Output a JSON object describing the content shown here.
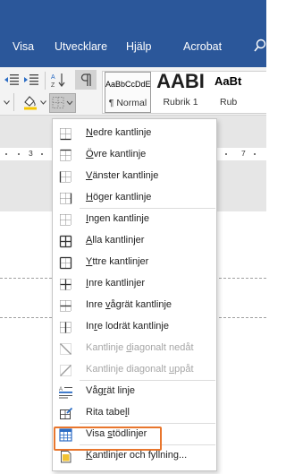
{
  "ribbon_tabs": [
    "Visa",
    "Utvecklare",
    "Hjälp",
    "Acrobat"
  ],
  "search": {
    "icon": "search-icon"
  },
  "toolbar": {
    "icons": [
      "decrease-indent-icon",
      "increase-indent-icon",
      "sort-icon",
      "paragraph-mark-icon",
      "shading-icon",
      "borders-icon",
      "dropdown-arrow-icon"
    ]
  },
  "styles": [
    {
      "sample": "AaBbCcDdE",
      "name": "¶ Normal",
      "selected": true
    },
    {
      "sample": "AABI",
      "name": "Rubrik 1",
      "selected": false
    },
    {
      "sample": "AaBt",
      "name": "Rub",
      "selected": false
    }
  ],
  "ruler": {
    "left_number": "3",
    "right_number": "7"
  },
  "border_menu": {
    "items": [
      {
        "pre": "",
        "u": "N",
        "post": "edre kantlinje",
        "icon": "bottom-border-icon",
        "enabled": true
      },
      {
        "pre": "",
        "u": "Ö",
        "post": "vre kantlinje",
        "icon": "top-border-icon",
        "enabled": true
      },
      {
        "pre": "",
        "u": "V",
        "post": "änster kantlinje",
        "icon": "left-border-icon",
        "enabled": true
      },
      {
        "pre": "",
        "u": "H",
        "post": "öger kantlinje",
        "icon": "right-border-icon",
        "enabled": true
      },
      {
        "pre": "",
        "u": "I",
        "post": "ngen kantlinje",
        "icon": "no-border-icon",
        "enabled": true
      },
      {
        "pre": "",
        "u": "A",
        "post": "lla kantlinjer",
        "icon": "all-borders-icon",
        "enabled": true
      },
      {
        "pre": "",
        "u": "Y",
        "post": "ttre kantlinjer",
        "icon": "outside-borders-icon",
        "enabled": true
      },
      {
        "pre": "",
        "u": "I",
        "post": "nre kantlinjer",
        "icon": "inside-borders-icon",
        "enabled": true
      },
      {
        "pre": "Inre ",
        "u": "v",
        "post": "ågrät kantlinje",
        "icon": "inside-horizontal-border-icon",
        "enabled": true
      },
      {
        "pre": "In",
        "u": "r",
        "post": "e lodrät kantlinje",
        "icon": "inside-vertical-border-icon",
        "enabled": true
      },
      {
        "pre": "Kantlinje ",
        "u": "d",
        "post": "iagonalt nedåt",
        "icon": "diagonal-down-border-icon",
        "enabled": false
      },
      {
        "pre": "Kantlinje diagonalt ",
        "u": "u",
        "post": "ppåt",
        "icon": "diagonal-up-border-icon",
        "enabled": false
      },
      {
        "pre": "Våg",
        "u": "r",
        "post": "ät linje",
        "icon": "horizontal-line-icon",
        "enabled": true
      },
      {
        "pre": "Rita tabe",
        "u": "l",
        "post": "l",
        "icon": "draw-table-icon",
        "enabled": true
      },
      {
        "pre": "Visa ",
        "u": "s",
        "post": "tödlinjer",
        "icon": "view-gridlines-icon",
        "enabled": true,
        "highlighted": true
      },
      {
        "pre": "",
        "u": "K",
        "post": "antlinjer och fyllning...",
        "icon": "borders-and-shading-icon",
        "enabled": true
      }
    ]
  },
  "colors": {
    "ribbon_blue": "#2b579a",
    "highlight_orange": "#e8762d"
  }
}
